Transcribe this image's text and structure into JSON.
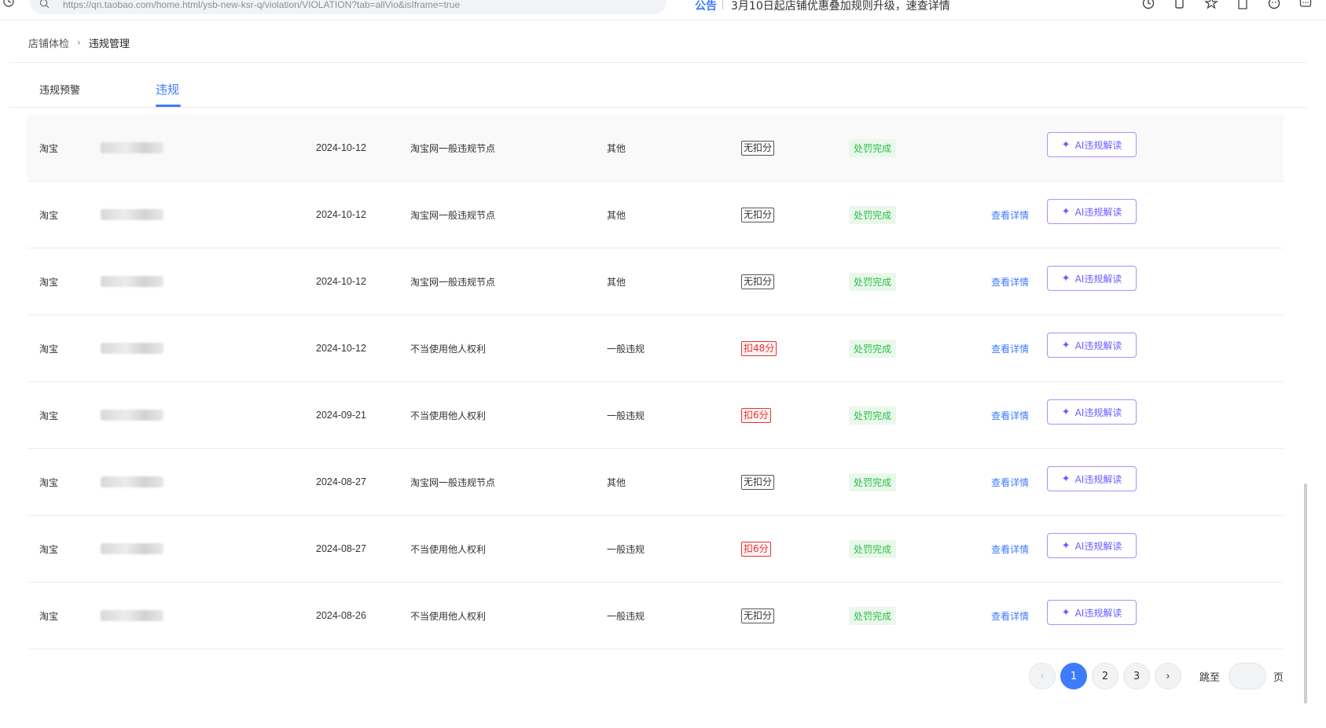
{
  "browser": {
    "url": "https://qn.taobao.com/home.html/ysb-new-ksr-q/violation/VIOLATION?tab=allVio&isIframe=true",
    "notice_label": "公告",
    "notice_text": "3月10日起店铺优惠叠加规则升级，速查详情"
  },
  "breadcrumb": {
    "parent": "店铺体检",
    "separator": "›",
    "current": "违规管理"
  },
  "tabs": {
    "warning": "违规预警",
    "violation": "违规"
  },
  "table": {
    "detail_label": "查看详情",
    "ai_label": "AI违规解读",
    "rows": [
      {
        "platform": "淘宝",
        "date": "2024-10-12",
        "reason": "淘宝网一般违规节点",
        "type": "其他",
        "deduction": "无扣分",
        "deducted": false,
        "status": "处罚完成",
        "has_detail": false
      },
      {
        "platform": "淘宝",
        "date": "2024-10-12",
        "reason": "淘宝网一般违规节点",
        "type": "其他",
        "deduction": "无扣分",
        "deducted": false,
        "status": "处罚完成",
        "has_detail": true
      },
      {
        "platform": "淘宝",
        "date": "2024-10-12",
        "reason": "淘宝网一般违规节点",
        "type": "其他",
        "deduction": "无扣分",
        "deducted": false,
        "status": "处罚完成",
        "has_detail": true
      },
      {
        "platform": "淘宝",
        "date": "2024-10-12",
        "reason": "不当使用他人权利",
        "type": "一般违规",
        "deduction": "扣48分",
        "deducted": true,
        "status": "处罚完成",
        "has_detail": true
      },
      {
        "platform": "淘宝",
        "date": "2024-09-21",
        "reason": "不当使用他人权利",
        "type": "一般违规",
        "deduction": "扣6分",
        "deducted": true,
        "status": "处罚完成",
        "has_detail": true
      },
      {
        "platform": "淘宝",
        "date": "2024-08-27",
        "reason": "淘宝网一般违规节点",
        "type": "其他",
        "deduction": "无扣分",
        "deducted": false,
        "status": "处罚完成",
        "has_detail": true
      },
      {
        "platform": "淘宝",
        "date": "2024-08-27",
        "reason": "不当使用他人权利",
        "type": "一般违规",
        "deduction": "扣6分",
        "deducted": true,
        "status": "处罚完成",
        "has_detail": true
      },
      {
        "platform": "淘宝",
        "date": "2024-08-26",
        "reason": "不当使用他人权利",
        "type": "一般违规",
        "deduction": "无扣分",
        "deducted": false,
        "status": "处罚完成",
        "has_detail": true
      }
    ]
  },
  "pagination": {
    "prev": "‹",
    "next": "›",
    "pages": [
      "1",
      "2",
      "3"
    ],
    "current": "1",
    "jump_label": "跳至",
    "page_suffix": "页"
  },
  "colors": {
    "accent": "#3d7bff",
    "danger": "#e8312f",
    "success": "#2ebd4e",
    "ai_purple": "#6a5cff"
  }
}
